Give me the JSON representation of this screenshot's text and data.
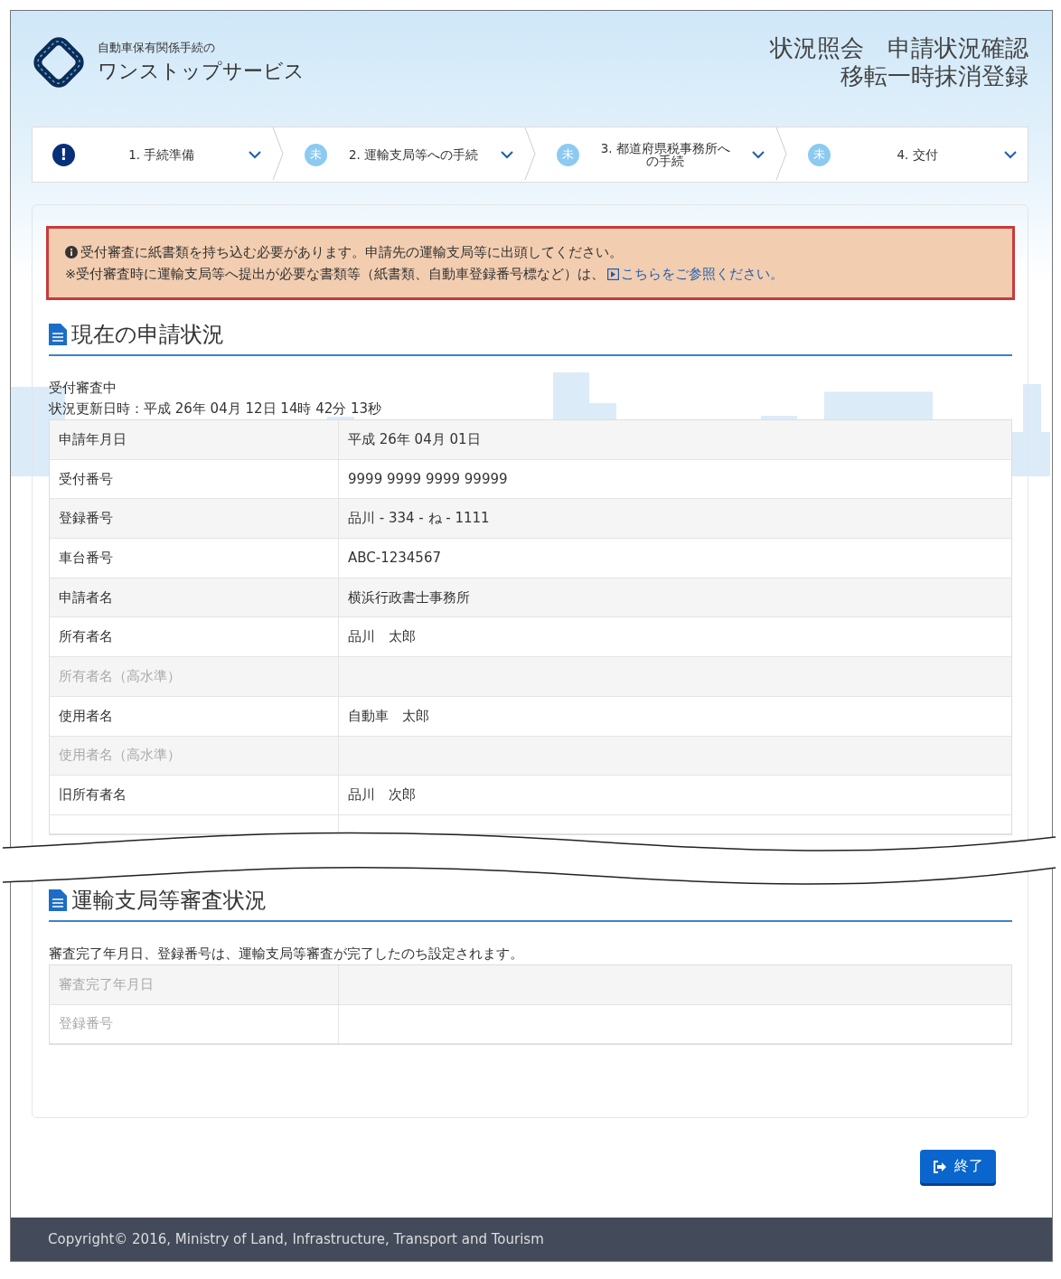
{
  "header": {
    "logo_subtitle": "自動車保有関係手続の",
    "logo_title": "ワンストップサービス",
    "page_title_lines": [
      "状況照会　申請状況確認",
      "移転一時抹消登録"
    ]
  },
  "steps": [
    {
      "kind": "alert",
      "icon": "!",
      "label": "1. 手続準備"
    },
    {
      "kind": "pending",
      "icon": "未",
      "label": "2. 運輸支局等への手続"
    },
    {
      "kind": "pending",
      "icon": "未",
      "label": "3. 都道府県税事務所への手続"
    },
    {
      "kind": "pending",
      "icon": "未",
      "label": "4. 交付"
    }
  ],
  "alert": {
    "line1": "受付審査に紙書類を持ち込む必要があります。申請先の運輸支局等に出頭してください。",
    "line2": "※受付審査時に運輸支局等へ提出が必要な書類等（紙書類、自動車登録番号標など）は、",
    "link": "こちらをご参照ください。"
  },
  "current_status": {
    "title": "現在の申請状況",
    "status": "受付審査中",
    "updated": "状況更新日時：平成 26年 04月 12日 14時 42分 13秒",
    "rows": [
      {
        "label": "申請年月日",
        "value": "平成 26年 04月 01日",
        "dimmed": false
      },
      {
        "label": "受付番号",
        "value": "9999 9999 9999 99999",
        "dimmed": false
      },
      {
        "label": "登録番号",
        "value": "品川 - 334 - ね - 1111",
        "dimmed": false
      },
      {
        "label": "車台番号",
        "value": "ABC-1234567",
        "dimmed": false
      },
      {
        "label": "申請者名",
        "value": "横浜行政書士事務所",
        "dimmed": false
      },
      {
        "label": "所有者名",
        "value": "品川　太郎",
        "dimmed": false
      },
      {
        "label": "所有者名（高水準）",
        "dimmed": true
      },
      {
        "label": "使用者名",
        "value": "自動車　太郎",
        "dimmed": false
      },
      {
        "label": "使用者名（高水準）",
        "dimmed": true
      },
      {
        "label": "旧所有者名",
        "value": "品川　次郎",
        "dimmed": false
      }
    ]
  },
  "review_status": {
    "title": "運輸支局等審査状況",
    "note": "審査完了年月日、登録番号は、運輸支局等審査が完了したのち設定されます。",
    "rows": [
      {
        "label": "審査完了年月日",
        "dimmed": true
      },
      {
        "label": "登録番号",
        "dimmed": true
      }
    ]
  },
  "finish_button": "終了",
  "footer": "Copyright© 2016, Ministry of Land, Infrastructure, Transport and Tourism"
}
